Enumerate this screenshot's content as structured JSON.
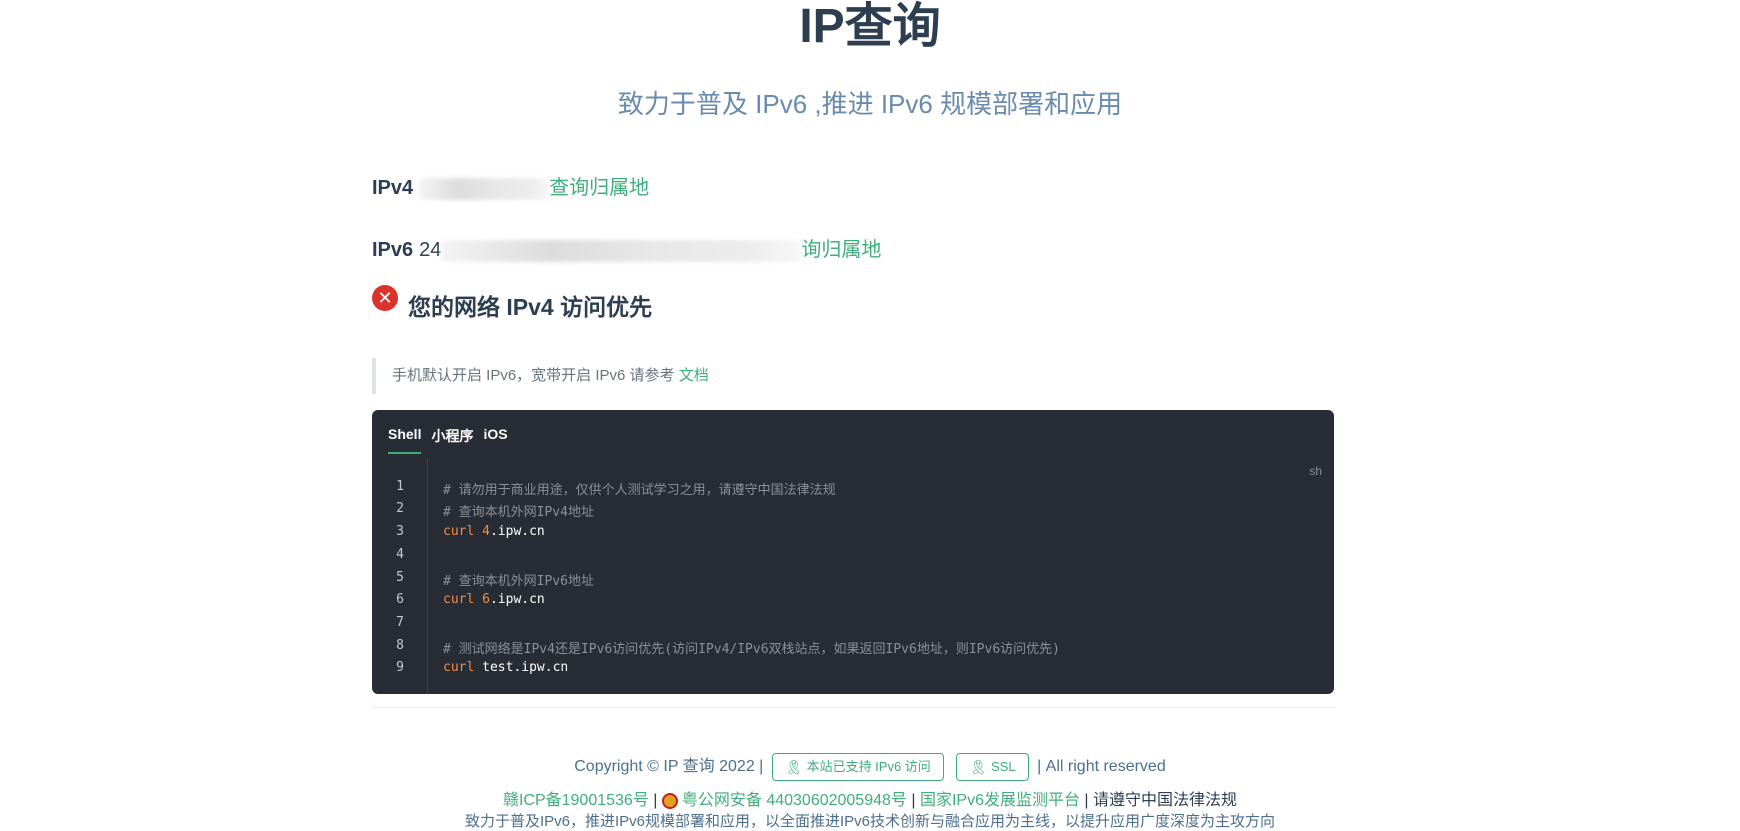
{
  "header": {
    "title": "IP查询",
    "subtitle": "致力于普及 IPv6 ,推进 IPv6 规模部署和应用"
  },
  "ip": {
    "ipv4_label": "IPv4",
    "ipv4_link": "查询归属地",
    "ipv6_label": "IPv6",
    "ipv6_prefix": "24",
    "ipv6_link": "询归属地"
  },
  "status": {
    "icon": "error-icon",
    "text": "您的网络 IPv4 访问优先"
  },
  "tip": {
    "text": "手机默认开启 IPv6，宽带开启 IPv6 请参考 ",
    "link": "文档"
  },
  "code": {
    "tabs": [
      "Shell",
      "小程序",
      "iOS"
    ],
    "active_tab": "Shell",
    "lang": "sh",
    "line_numbers": [
      "1",
      "2",
      "3",
      "4",
      "5",
      "6",
      "7",
      "8",
      "9"
    ],
    "lines": [
      {
        "kind": "comment",
        "text": "# 请勿用于商业用途，仅供个人测试学习之用，请遵守中国法律法规"
      },
      {
        "kind": "comment",
        "text": "# 查询本机外网IPv4地址"
      },
      {
        "kind": "cmd",
        "cmd": "curl",
        "num": "4",
        "rest": ".ipw.cn"
      },
      {
        "kind": "blank",
        "text": ""
      },
      {
        "kind": "comment",
        "text": "# 查询本机外网IPv6地址"
      },
      {
        "kind": "cmd",
        "cmd": "curl",
        "num": "6",
        "rest": ".ipw.cn"
      },
      {
        "kind": "blank",
        "text": ""
      },
      {
        "kind": "comment",
        "text": "# 测试网络是IPv4还是IPv6访问优先(访问IPv4/IPv6双栈站点，如果返回IPv6地址，则IPv6访问优先)"
      },
      {
        "kind": "cmd",
        "cmd": "curl",
        "num": "",
        "rest": " test.ipw.cn"
      }
    ]
  },
  "footer": {
    "copyright": "Copyright © IP 查询 2022 |",
    "ipv6_badge": "本站已支持 IPv6 访问",
    "ssl_badge": "SSL",
    "rights": "| All right reserved",
    "icp": "赣ICP备19001536号",
    "sep1": " | ",
    "police": "粤公网安备 44030602005948号",
    "sep2": " | ",
    "monitor": "国家IPv6发展监测平台",
    "sep3": " | ",
    "law": "请遵守中国法律法规",
    "slogan": "致力于普及IPv6，推进IPv6规模部署和应用，以全面推进IPv6技术创新与融合应用为主线，以提升应用广度深度为主攻方向"
  },
  "colors": {
    "accent": "#3eaf7c",
    "text": "#2c3e50",
    "subtitle": "#6a8bad",
    "error": "#d9332c",
    "code_bg": "#282c34",
    "code_number": "#f08d49"
  }
}
